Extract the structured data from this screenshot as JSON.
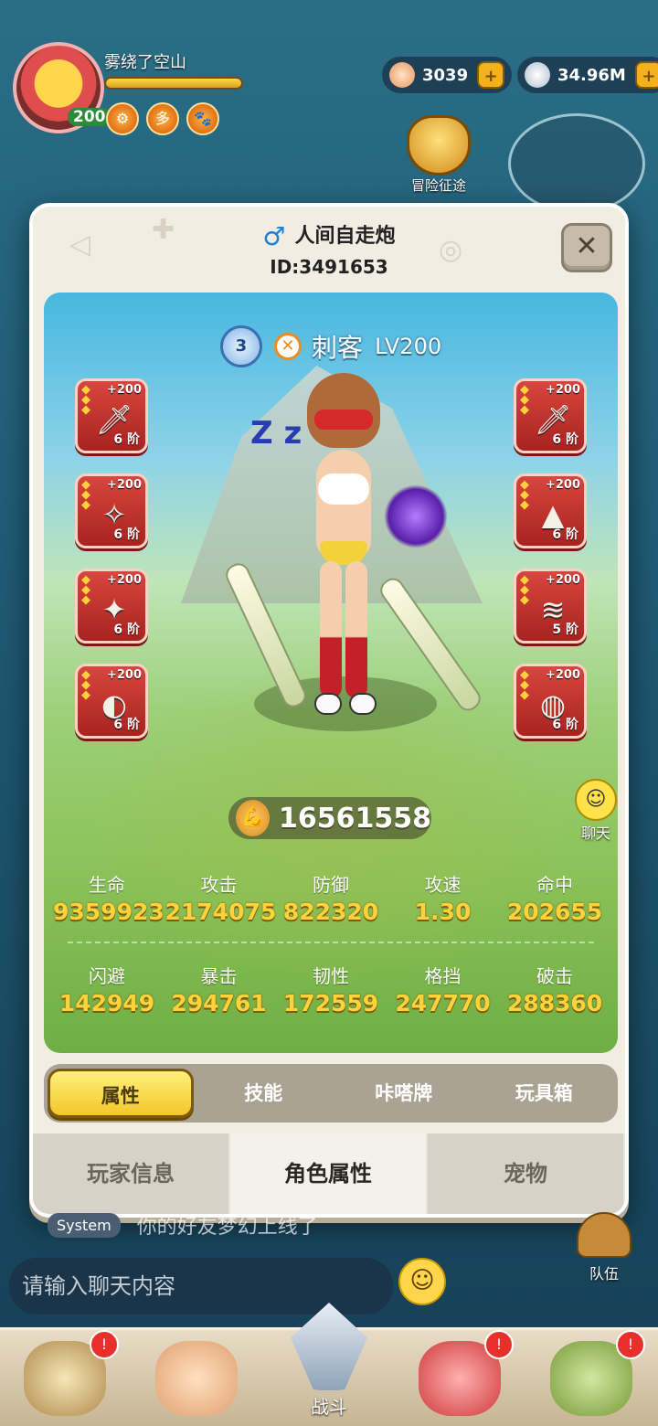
{
  "hud": {
    "player_name": "雾绕了空山",
    "level": "200",
    "badges": [
      "⚙",
      "多",
      "🐾"
    ],
    "currency1": "3039",
    "currency2": "34.96M",
    "plus": "+",
    "adventure_label": "冒险征途"
  },
  "modal": {
    "player_name": "人间自走炮",
    "player_id": "ID:3491653",
    "close_symbol": "✕",
    "gender": "♂",
    "class_name": "刺客",
    "class_level": "LV200",
    "class_rank_label": "3",
    "zzz": "Z z",
    "power": "16561558",
    "equipment_left": [
      {
        "plus": "+200",
        "stage": "6 阶",
        "glyph": "🗡"
      },
      {
        "plus": "+200",
        "stage": "6 阶",
        "glyph": "✧"
      },
      {
        "plus": "+200",
        "stage": "6 阶",
        "glyph": "✦"
      },
      {
        "plus": "+200",
        "stage": "6 阶",
        "glyph": "◐"
      }
    ],
    "equipment_right": [
      {
        "plus": "+200",
        "stage": "6 阶",
        "glyph": "🗡"
      },
      {
        "plus": "+200",
        "stage": "6 阶",
        "glyph": "▲"
      },
      {
        "plus": "+200",
        "stage": "5 阶",
        "glyph": "≋"
      },
      {
        "plus": "+200",
        "stage": "6 阶",
        "glyph": "◍"
      }
    ],
    "stats_row1": [
      {
        "label": "生命",
        "value": "9359923"
      },
      {
        "label": "攻击",
        "value": "2174075"
      },
      {
        "label": "防御",
        "value": "822320"
      },
      {
        "label": "攻速",
        "value": "1.30"
      },
      {
        "label": "命中",
        "value": "202655"
      }
    ],
    "stats_row2": [
      {
        "label": "闪避",
        "value": "142949"
      },
      {
        "label": "暴击",
        "value": "294761"
      },
      {
        "label": "韧性",
        "value": "172559"
      },
      {
        "label": "格挡",
        "value": "247770"
      },
      {
        "label": "破击",
        "value": "288360"
      }
    ],
    "subtabs": [
      "属性",
      "技能",
      "咔嗒牌",
      "玩具箱"
    ],
    "subtab_active": 0,
    "maintabs": [
      "玩家信息",
      "角色属性",
      "宠物"
    ],
    "maintab_active": 1
  },
  "chat": {
    "chat_button_label": "聊天",
    "system_tag": "System",
    "system_message": "你的好友梦幻上线了",
    "input_placeholder": "请输入聊天内容",
    "emoji": "☺",
    "team_label": "队伍"
  },
  "bottom_nav": {
    "battle_label": "战斗",
    "bell": "🔔"
  },
  "colors": {
    "accent_gold": "#ffd23a",
    "equip_red": "#c93530",
    "active_tab": "#f4c72a",
    "gender_blue": "#1e7fd6"
  }
}
